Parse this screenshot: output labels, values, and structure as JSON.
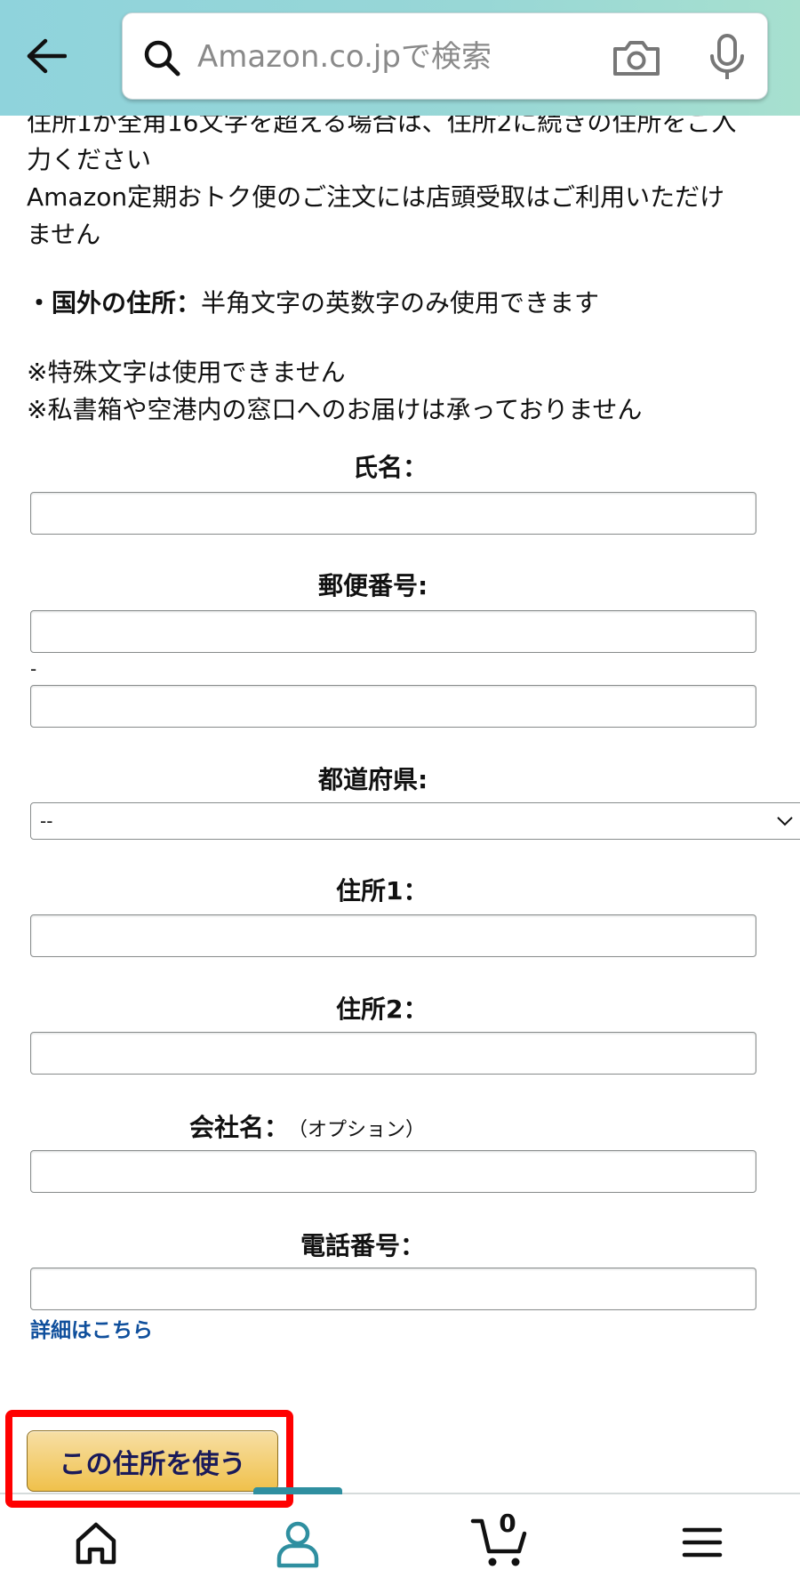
{
  "header": {
    "search_placeholder": "Amazon.co.jpで検索",
    "back_icon": "arrow-left-icon",
    "search_icon": "search-icon",
    "camera_icon": "camera-icon",
    "mic_icon": "microphone-icon",
    "gradient_start": "#8fd3dc",
    "gradient_end": "#a7e0cf"
  },
  "notice": {
    "line1": "住所1が全角16文字を超える場合は、住所2に続きの住所をご入",
    "line2": "力ください",
    "line3": "Amazon定期おトク便のご注文には店頭受取はご利用いただけ",
    "line4": "ません",
    "intl_bold": "・国外の住所：",
    "intl_text": "半角文字の英数字のみ使用できます",
    "special_chars": "※特殊文字は使用できません",
    "po_box": "※私書箱や空港内の窓口へのお届けは承っておりません"
  },
  "form": {
    "name_label": "氏名：",
    "postal_label": "郵便番号:",
    "postal_separator": "-",
    "prefecture_label": "都道府県:",
    "prefecture_value": "--",
    "address1_label": "住所1：",
    "address2_label": "住所2：",
    "company_label": "会社名：",
    "company_optional": "（オプション）",
    "phone_label": "電話番号：",
    "details_link": "詳細はこちら"
  },
  "submit": {
    "label": "この住所を使う",
    "highlight_color": "#ff0000"
  },
  "bottom_nav": {
    "items": [
      "home-icon",
      "account-icon",
      "cart-icon",
      "menu-icon"
    ],
    "cart_count": "0",
    "active_color": "#2f8fa0"
  }
}
